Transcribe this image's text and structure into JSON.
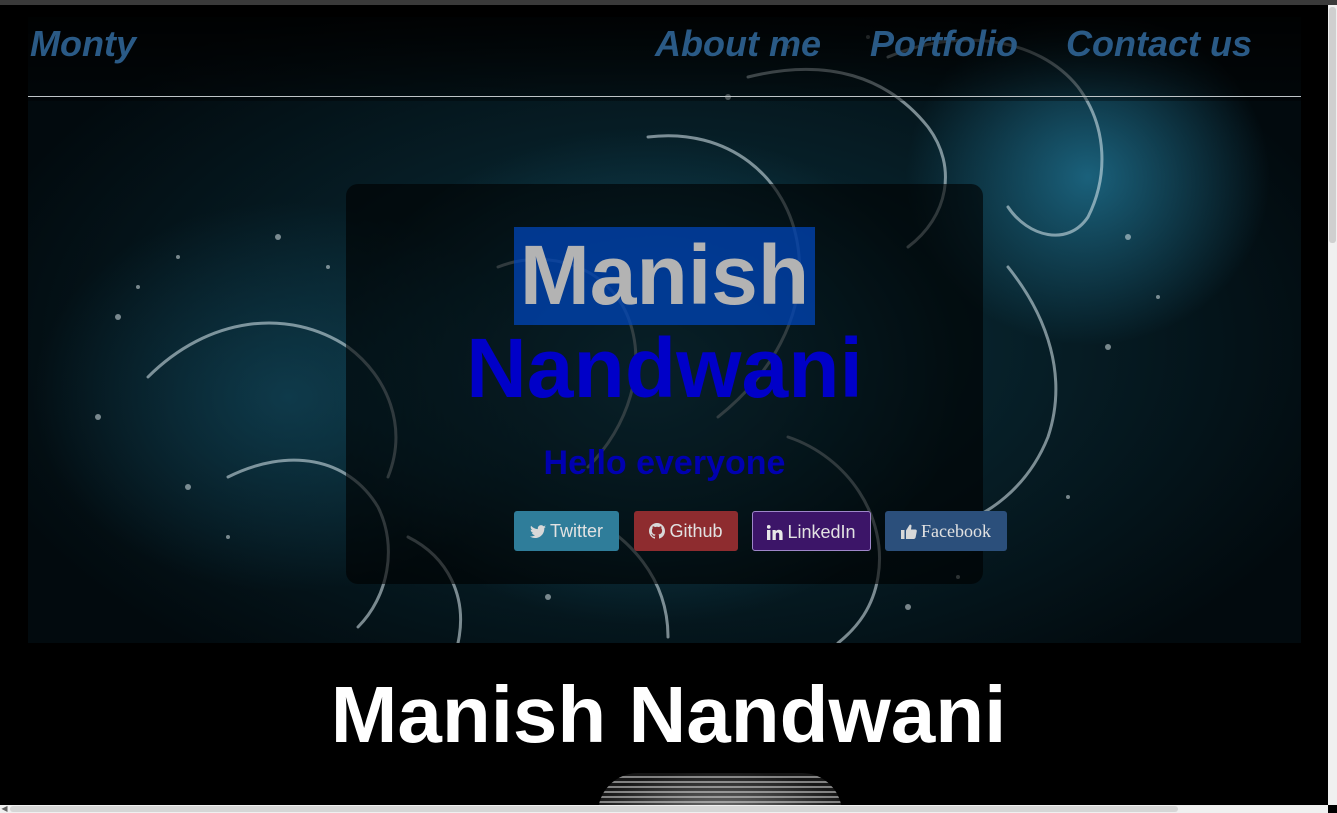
{
  "nav": {
    "brand": "Monty",
    "links": [
      "About me",
      "Portfolio",
      "Contact us"
    ]
  },
  "hero": {
    "first_name": "Manish",
    "last_name": "Nandwani",
    "greeting": "Hello everyone",
    "buttons": {
      "twitter": "Twitter",
      "github": "Github",
      "linkedin": "LinkedIn",
      "facebook": "Facebook"
    }
  },
  "footer": {
    "title": "Manish Nandwani"
  },
  "colors": {
    "nav_text": "#2a5a86",
    "first_name_highlight": "#0046be",
    "last_name": "#0000c8",
    "twitter": "#2f7d9a",
    "github": "#8e2c2f",
    "linkedin": "#3c1568",
    "facebook": "#2b4f7b"
  },
  "icons": {
    "twitter": "twitter-bird-icon",
    "github": "github-octocat-icon",
    "linkedin": "linkedin-in-icon",
    "facebook": "thumbs-up-icon"
  }
}
